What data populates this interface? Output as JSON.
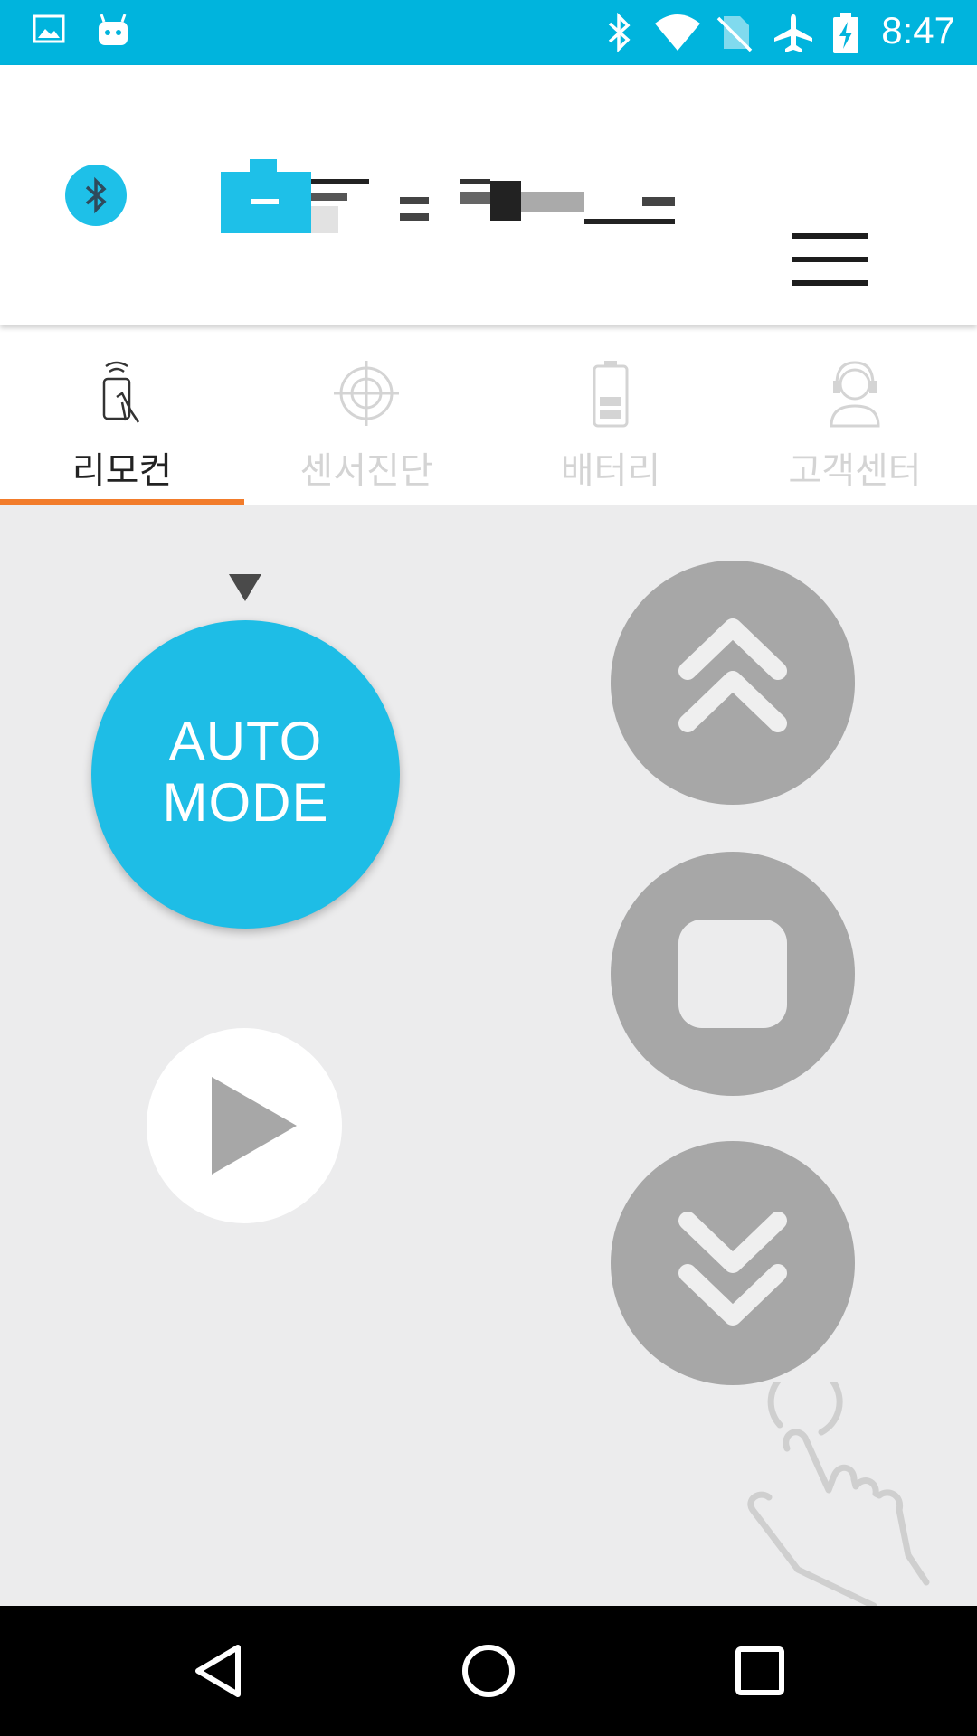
{
  "status_bar": {
    "time": "8:47",
    "icons": [
      "image-icon",
      "android-icon",
      "bluetooth-icon",
      "wifi-icon",
      "no-sim-icon",
      "airplane-icon",
      "battery-charging-icon"
    ],
    "color": "#00b4dd"
  },
  "header": {
    "bluetooth_icon": "bluetooth-icon",
    "logo_text": "",
    "menu_icon": "hamburger-menu-icon",
    "accent_color": "#1ec0e8"
  },
  "tabs": [
    {
      "label": "리모컨",
      "icon": "remote-hand-icon",
      "active": true
    },
    {
      "label": "센서진단",
      "icon": "crosshair-icon",
      "active": false
    },
    {
      "label": "배터리",
      "icon": "battery-icon",
      "active": false
    },
    {
      "label": "고객센터",
      "icon": "customer-service-icon",
      "active": false
    }
  ],
  "tab_indicator_color": "#f27c2b",
  "controls": {
    "auto_mode_line1": "AUTO",
    "auto_mode_line2": "MODE",
    "auto_mode_color": "#1ebde6",
    "play_icon": "play-icon",
    "up_icon": "double-chevron-up-icon",
    "stop_icon": "stop-icon",
    "down_icon": "double-chevron-down-icon",
    "hint_icon": "tap-hand-icon"
  },
  "nav_bar": {
    "back": "back-icon",
    "home": "home-icon",
    "recents": "recents-icon"
  }
}
